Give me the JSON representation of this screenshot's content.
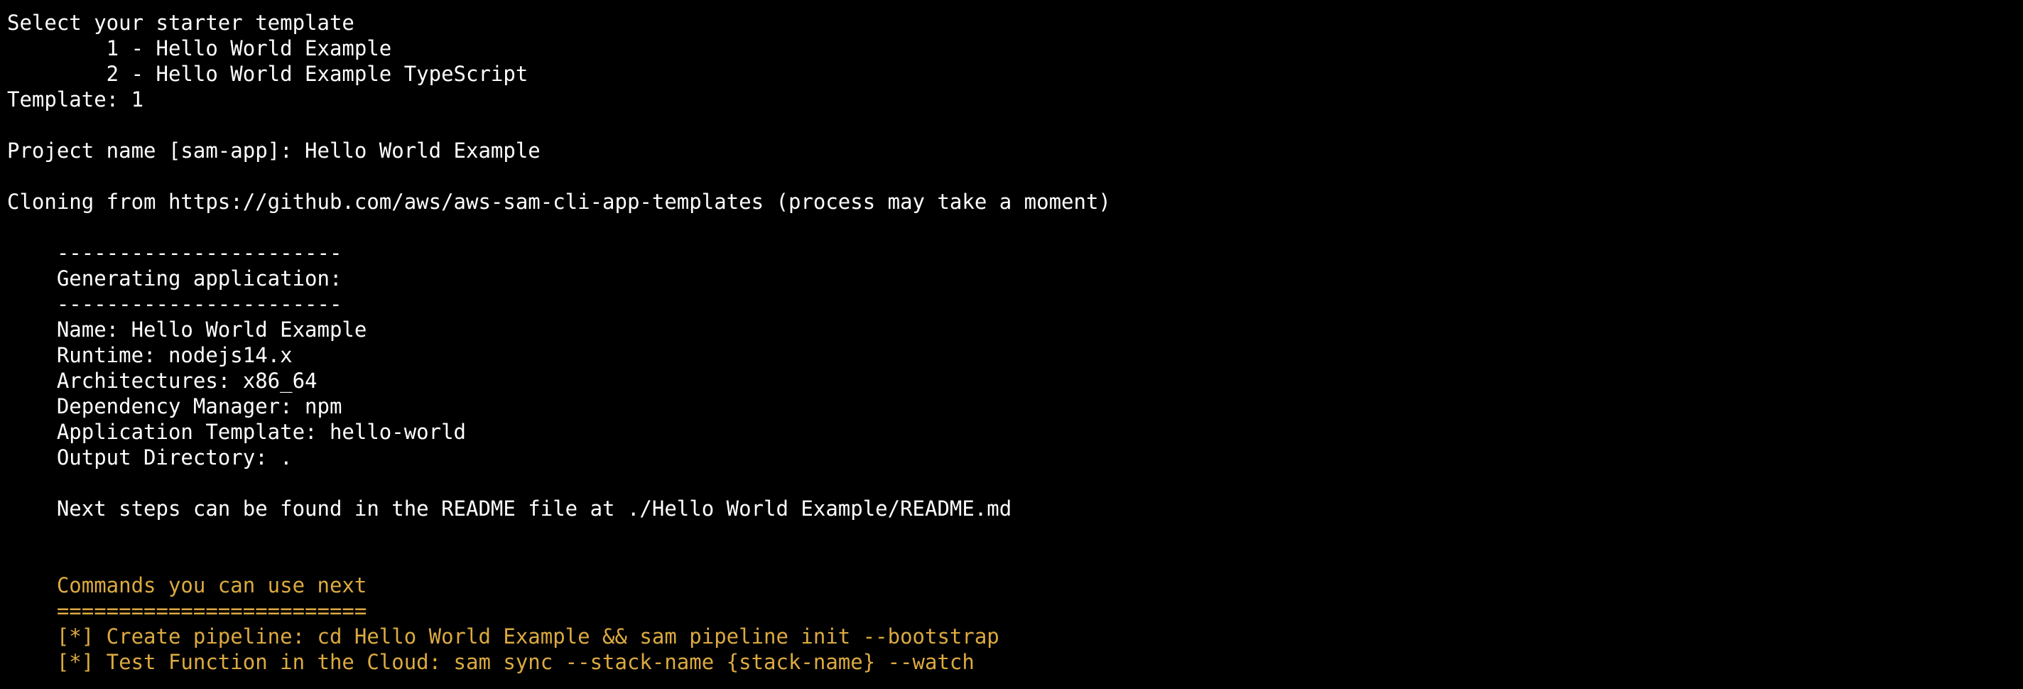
{
  "colors": {
    "background": "#000000",
    "text": "#ffffff",
    "highlight": "#dcaa40"
  },
  "terminal": {
    "lines": [
      {
        "text": "Select your starter template",
        "style": "normal"
      },
      {
        "text": "        1 - Hello World Example",
        "style": "normal"
      },
      {
        "text": "        2 - Hello World Example TypeScript",
        "style": "normal"
      },
      {
        "text": "Template: 1",
        "style": "normal"
      },
      {
        "text": "",
        "style": "normal"
      },
      {
        "text": "Project name [sam-app]: Hello World Example",
        "style": "normal"
      },
      {
        "text": "",
        "style": "normal"
      },
      {
        "text": "Cloning from https://github.com/aws/aws-sam-cli-app-templates (process may take a moment)",
        "style": "normal"
      },
      {
        "text": "",
        "style": "normal"
      },
      {
        "text": "    -----------------------",
        "style": "normal"
      },
      {
        "text": "    Generating application:",
        "style": "normal"
      },
      {
        "text": "    -----------------------",
        "style": "normal"
      },
      {
        "text": "    Name: Hello World Example",
        "style": "normal"
      },
      {
        "text": "    Runtime: nodejs14.x",
        "style": "normal"
      },
      {
        "text": "    Architectures: x86_64",
        "style": "normal"
      },
      {
        "text": "    Dependency Manager: npm",
        "style": "normal"
      },
      {
        "text": "    Application Template: hello-world",
        "style": "normal"
      },
      {
        "text": "    Output Directory: .",
        "style": "normal"
      },
      {
        "text": "",
        "style": "normal"
      },
      {
        "text": "    Next steps can be found in the README file at ./Hello World Example/README.md",
        "style": "normal"
      },
      {
        "text": "",
        "style": "normal"
      },
      {
        "text": "",
        "style": "normal"
      },
      {
        "text": "    Commands you can use next",
        "style": "yellow"
      },
      {
        "text": "    =========================",
        "style": "yellow"
      },
      {
        "text": "    [*] Create pipeline: cd Hello World Example && sam pipeline init --bootstrap",
        "style": "yellow"
      },
      {
        "text": "    [*] Test Function in the Cloud: sam sync --stack-name {stack-name} --watch",
        "style": "yellow"
      }
    ]
  }
}
